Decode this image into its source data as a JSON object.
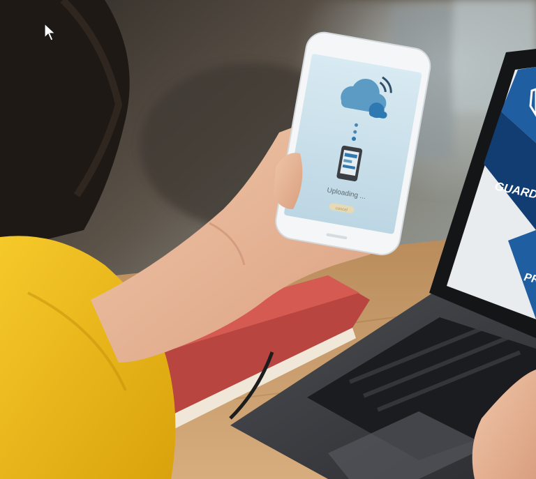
{
  "photo": {
    "phone_screen": {
      "status_text": "Uploading ...",
      "button_label": "cancel",
      "icons": [
        "cloud-icon",
        "wifi-signal-icon",
        "phone-icon"
      ]
    },
    "laptop_screen": {
      "tile_labels": [
        "GUARD",
        "PR"
      ],
      "icons": [
        "shield-icon"
      ]
    },
    "cursor": "mouse-pointer-icon",
    "colors": {
      "sweater_yellow": "#f2c01b",
      "notebook_red": "#c9514a",
      "laptop_blue": "#1f5ea0",
      "laptop_navy": "#123d73",
      "phone_screen_bg": "#cfe3ee",
      "cloud_blue": "#5c9cc4",
      "table_wood": "#c79a6a"
    }
  }
}
